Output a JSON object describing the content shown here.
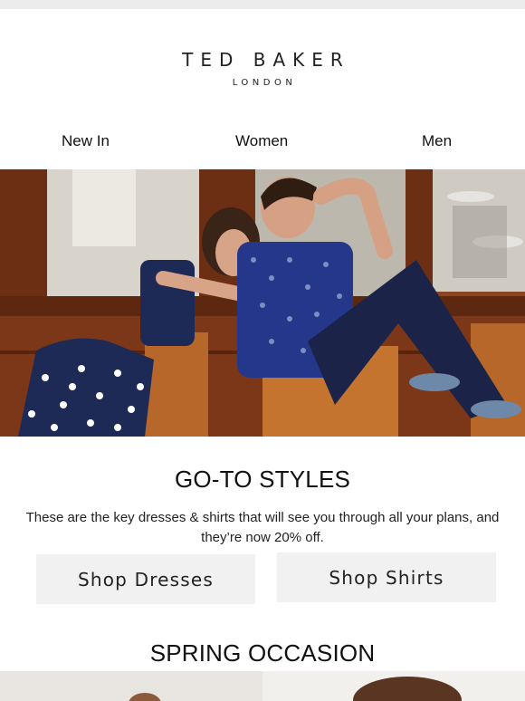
{
  "brand": {
    "name": "TED BAKER",
    "tagline": "LONDON"
  },
  "nav": {
    "items": [
      "New In",
      "Women",
      "Men"
    ]
  },
  "section1": {
    "heading": "GO-TO STYLES",
    "body": "These are the key dresses & shirts that will see you through all your plans, and they’re now 20% off.",
    "buttons": {
      "dresses": "Shop Dresses",
      "shirts": "Shop Shirts"
    }
  },
  "section2": {
    "heading": "SPRING OCCASION"
  },
  "colors": {
    "top_bar": "#ececec",
    "button_bg": "#f1f1f1",
    "hero_wood": "#7a3a1c",
    "navy": "#1c2a55"
  }
}
